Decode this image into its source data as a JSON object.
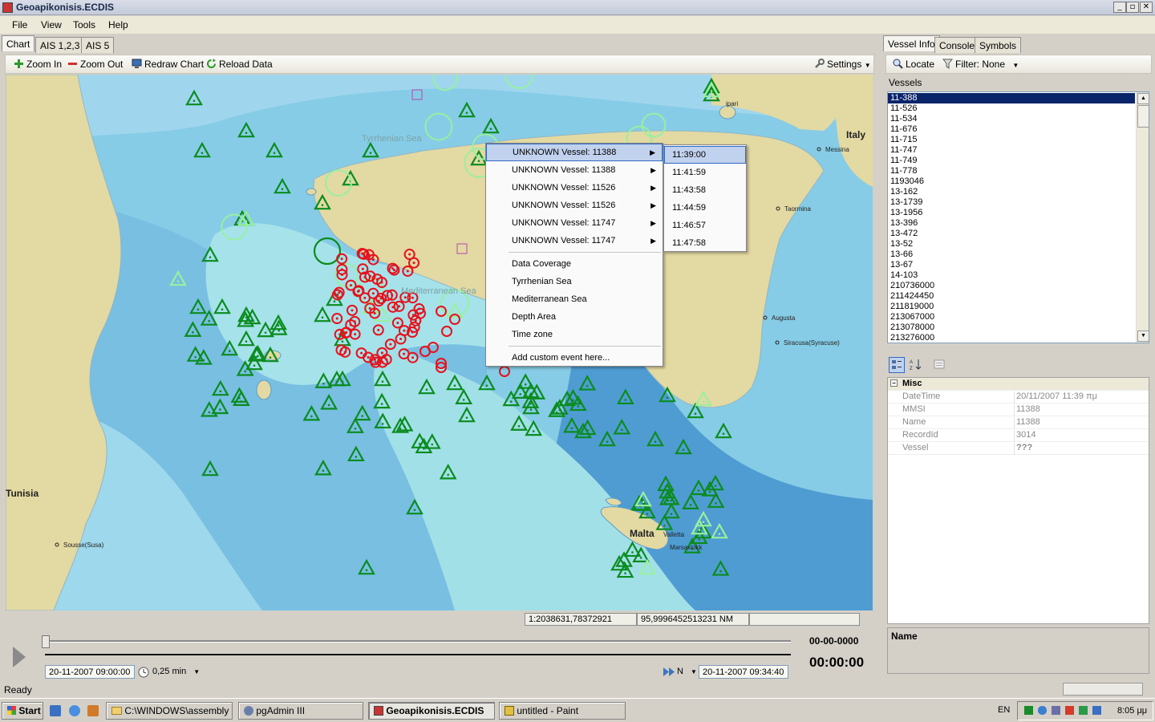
{
  "window": {
    "title": "Geoapikonisis.ECDIS"
  },
  "menu": [
    "File",
    "View",
    "Tools",
    "Help"
  ],
  "tabs": [
    "Chart",
    "AIS 1,2,3",
    "AIS 5"
  ],
  "right_tabs": [
    "Vessel Info",
    "Console",
    "Symbols"
  ],
  "toolbar": {
    "zoom_in": "Zoom In",
    "zoom_out": "Zoom Out",
    "redraw": "Redraw Chart",
    "reload": "Reload Data",
    "settings": "Settings"
  },
  "right_toolbar": {
    "locate": "Locate",
    "filter": "Filter: None"
  },
  "map_labels": {
    "tyrrhenian": "Tyrrhenian Sea",
    "mediterranean": "Mediterranean Sea",
    "italy": "Italy",
    "tunisia": "Tunisia",
    "malta": "Malta",
    "messina": "Messina",
    "taormina": "Taormina",
    "augusta": "Augusta",
    "siracusa": "Siracusa(Syracuse)",
    "sousse": "Sousse(Susa)",
    "marsaxlokk": "Marsaxlokk",
    "lipari": "ipari",
    "valletta": "Valletta"
  },
  "context_menu": {
    "vessels": [
      "UNKNOWN Vessel: 11388",
      "UNKNOWN Vessel: 11388",
      "UNKNOWN Vessel: 11526",
      "UNKNOWN Vessel: 11526",
      "UNKNOWN Vessel: 11747",
      "UNKNOWN Vessel: 11747"
    ],
    "layers": [
      "Data Coverage",
      "Tyrrhenian Sea",
      "Mediterranean Sea",
      "Depth Area",
      "Time zone"
    ],
    "custom": "Add custom event here..."
  },
  "submenu_times": [
    "11:39:00",
    "11:41:59",
    "11:43:58",
    "11:44:59",
    "11:46:57",
    "11:47:58"
  ],
  "status": {
    "scale": "1:2038631,78372921",
    "distance": "95,9996452513231 NM",
    "ready": "Ready"
  },
  "playback": {
    "start": "20-11-2007 09:00:00",
    "step": "0,25 min",
    "direction": "N",
    "end": "20-11-2007 09:34:40",
    "date_counter": "00-00-0000",
    "time_counter": "00:00:00"
  },
  "vessels_label": "Vessels",
  "vessels": [
    "11-388",
    "11-526",
    "11-534",
    "11-676",
    "11-715",
    "11-747",
    "11-749",
    "11-778",
    "1193046",
    "13-162",
    "13-1739",
    "13-1956",
    "13-396",
    "13-472",
    "13-52",
    "13-66",
    "13-67",
    "14-103",
    "210736000",
    "211424450",
    "211819000",
    "213067000",
    "213078000",
    "213276000"
  ],
  "selected_vessel": "11-388",
  "properties": {
    "category": "Misc",
    "rows": [
      {
        "name": "DateTime",
        "value": "20/11/2007 11:39 πμ"
      },
      {
        "name": "MMSI",
        "value": "11388"
      },
      {
        "name": "Name",
        "value": "11388"
      },
      {
        "name": "RecordId",
        "value": "3014"
      },
      {
        "name": "Vessel",
        "value": "???"
      }
    ],
    "description_title": "Name"
  },
  "taskbar": {
    "start": "Start",
    "tasks": [
      "C:\\WINDOWS\\assembly",
      "pgAdmin III",
      "Geoapikonisis.ECDIS",
      "untitled - Paint"
    ],
    "lang": "EN",
    "clock": "8:05 μμ"
  },
  "colors": {
    "sea_shallow": "#a8e4ea",
    "sea_mid": "#8fd0e8",
    "sea_deep": "#6fb0dc",
    "land": "#e3d9a2",
    "vessel_green": "#0a8c1e",
    "vessel_light": "#98f0a0",
    "vessel_red": "#e8101a",
    "selection": "#0a246a"
  },
  "chart_data": {
    "green_triangles": 118,
    "light_triangles": 12,
    "red_circles": 64,
    "light_circles": 12
  }
}
